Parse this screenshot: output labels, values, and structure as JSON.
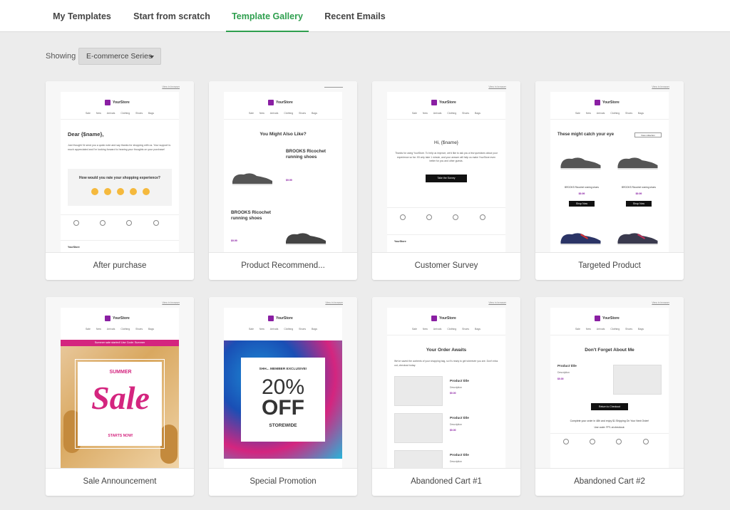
{
  "tabs": [
    {
      "label": "My Templates",
      "active": false
    },
    {
      "label": "Start from scratch",
      "active": false
    },
    {
      "label": "Template Gallery",
      "active": true
    },
    {
      "label": "Recent Emails",
      "active": false
    }
  ],
  "filter": {
    "label": "Showing",
    "value": "E-commerce Series"
  },
  "preview": {
    "view_in_browser": "View in browser",
    "store_name": "YourStore",
    "nav": "Sale New Arrivals Clothing Shoes Bags",
    "product_title": "Product title",
    "description": "Description",
    "price": "$0.00",
    "shoe_name": "BROOKS Ricochet running shoes",
    "shoe_name_small": "BROOKS Ricochet running shoes",
    "shoe_price": "$9.99",
    "shop_now": "Shop Now",
    "footer_store": "YourStore"
  },
  "templates": [
    {
      "name": "After purchase",
      "greeting": "Dear {$name},",
      "body": "Just thought I'd send you a quick note and say thanks for shopping with us. Your support is much appreciated and I'm looking forward to hearing your thoughts on your purchase!",
      "question": "How would you rate your shopping experience?"
    },
    {
      "name": "Product Recommend...",
      "heading": "You Might Also Like?"
    },
    {
      "name": "Customer Survey",
      "greeting": "Hi, {$name}",
      "body": "Thanks for using YourStore. To help us improve, we'd like to ask you a few questions about your experience so far. It'll only take 1 minute, and your answer will help us make YourStore even better for you and other guests.",
      "button": "Take the Survey"
    },
    {
      "name": "Targeted Product",
      "heading": "These might catch your eye",
      "view_button": "View collection"
    },
    {
      "name": "Sale Announcement",
      "banner": "Summer sale started! Use Code: Summer",
      "summer": "SUMMER",
      "sale": "Sale",
      "starts": "STARTS NOW!"
    },
    {
      "name": "Special Promotion",
      "exclusive": "SHH... MEMBER EXCLUSIVE!",
      "big": "20%",
      "off": "OFF",
      "storewide": "STOREWIDE"
    },
    {
      "name": "Abandoned Cart #1",
      "heading": "Your Order Awaits",
      "body": "We've saved the contents of your shopping bag, so it's ready to get wherever you are. Don't miss out, checkout today."
    },
    {
      "name": "Abandoned Cart #2",
      "heading": "Don't Forget About Me",
      "button": "Return to Checkout",
      "body": "Complete your order in 48h and enjoy $1 Shipping On Your Next Order!",
      "code": "Use code: FP1 at checkout."
    }
  ],
  "colors": {
    "accent": "#2e9f4e",
    "brand": "#8a1fa3",
    "sale_pink": "#d4257f"
  }
}
